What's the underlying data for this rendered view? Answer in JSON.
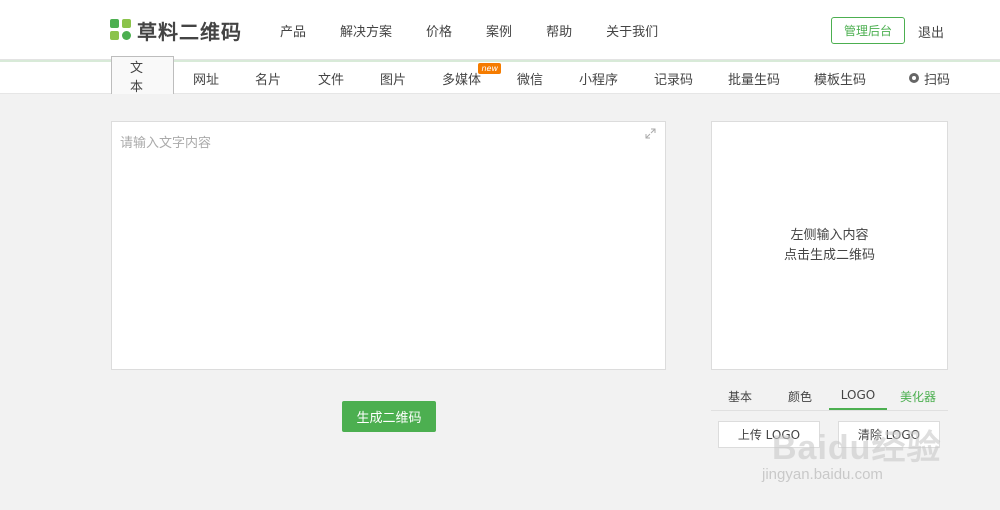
{
  "brand": {
    "name": "草料二维码",
    "color": "#4caf50"
  },
  "topnav": {
    "items": [
      "产品",
      "解决方案",
      "价格",
      "案例",
      "帮助",
      "关于我们"
    ],
    "admin_label": "管理后台",
    "logout_label": "退出"
  },
  "subnav": {
    "tabs": [
      "文本",
      "网址",
      "名片",
      "文件",
      "图片",
      "多媒体",
      "微信",
      "小程序",
      "记录码",
      "批量生码",
      "模板生码"
    ],
    "active": "文本",
    "new_badge": "new",
    "scan_label": "扫码"
  },
  "editor": {
    "placeholder": "请输入文字内容",
    "value": ""
  },
  "generate_label": "生成二维码",
  "preview": {
    "line1": "左侧输入内容",
    "line2": "点击生成二维码"
  },
  "options": {
    "tabs": [
      "基本",
      "颜色",
      "LOGO",
      "美化器"
    ],
    "active": "LOGO",
    "upload_label": "上传 LOGO",
    "clear_label": "清除 LOGO"
  },
  "watermark": {
    "top": "Baidu经验",
    "bottom": "jingyan.baidu.com"
  }
}
